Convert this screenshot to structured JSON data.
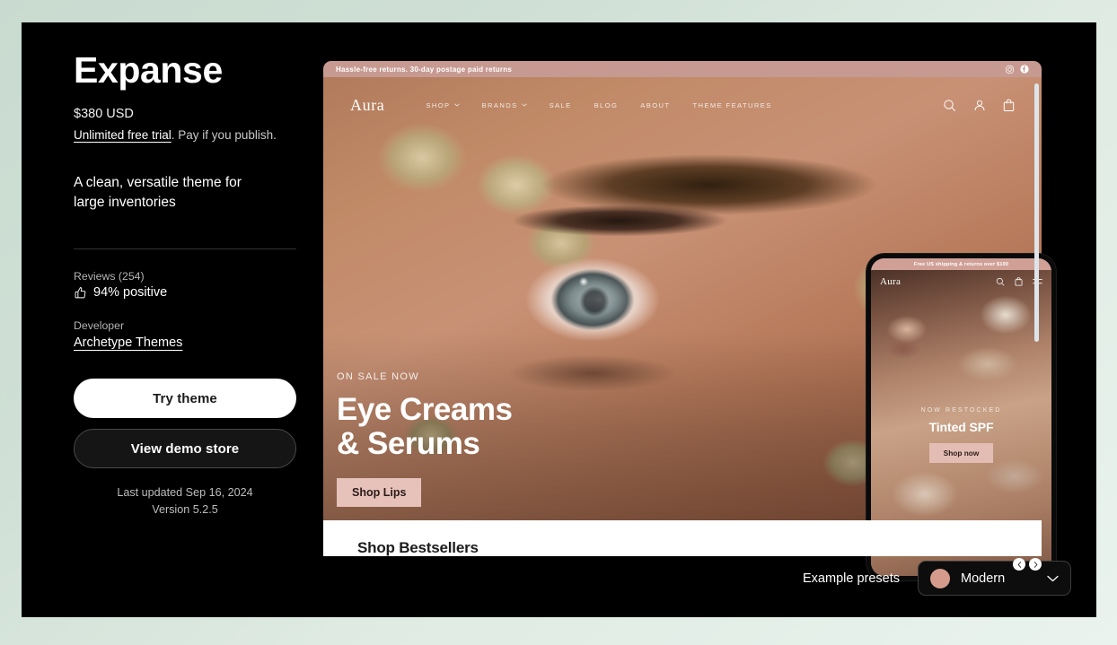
{
  "theme": {
    "title": "Expanse",
    "price": "$380 USD",
    "trial_link": "Unlimited free trial",
    "trial_rest": ". Pay if you publish.",
    "tagline": "A clean, versatile theme for large inventories",
    "reviews_label": "Reviews (254)",
    "reviews_value": "94% positive",
    "developer_label": "Developer",
    "developer_name": "Archetype Themes",
    "try_button": "Try theme",
    "demo_button": "View demo store",
    "last_updated": "Last updated Sep 16, 2024",
    "version": "Version 5.2.5"
  },
  "preview": {
    "announcement": "Hassle-free returns. 30-day postage paid returns",
    "logo": "Aura",
    "nav": [
      {
        "label": "SHOP",
        "caret": true
      },
      {
        "label": "BRANDS",
        "caret": true
      },
      {
        "label": "SALE",
        "caret": false
      },
      {
        "label": "BLOG",
        "caret": false
      },
      {
        "label": "ABOUT",
        "caret": false
      },
      {
        "label": "THEME FEATURES",
        "caret": false
      }
    ],
    "hero_eyebrow": "ON SALE NOW",
    "hero_title_line1": "Eye Creams",
    "hero_title_line2": "& Serums",
    "hero_button": "Shop Lips",
    "section_heading": "Shop Bestsellers"
  },
  "phone": {
    "announcement": "Free US shipping & returns over $100",
    "logo": "Aura",
    "eyebrow": "NOW RESTOCKED",
    "title": "Tinted SPF",
    "button": "Shop now"
  },
  "presets": {
    "label": "Example presets",
    "selected": "Modern",
    "swatch_color": "#d49b8d"
  },
  "colors": {
    "page_background": "#cfdfd5",
    "card_background": "#000000",
    "accent_rose": "#c79a91",
    "hero_button": "#e6c2bb"
  }
}
